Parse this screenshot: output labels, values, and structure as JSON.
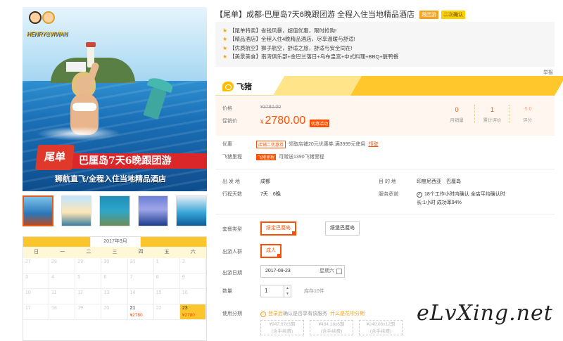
{
  "hero": {
    "logo_text": "HENRY&VIVIAN",
    "ribbon_tag": "尾单",
    "ribbon_text": "巴厘岛7天6晚跟团游",
    "subtitle": "狮航直飞/全程入住当地精品酒店"
  },
  "thumbnails": [
    "thumb-1",
    "thumb-2",
    "thumb-3",
    "thumb-4",
    "thumb-5"
  ],
  "calendar": {
    "month": "2017年9月",
    "weekdays": [
      "日",
      "一",
      "二",
      "三",
      "四",
      "五",
      "六"
    ],
    "cells": [
      {
        "day": "27",
        "state": "prev"
      },
      {
        "day": "28",
        "state": "prev"
      },
      {
        "day": "29",
        "state": "prev"
      },
      {
        "day": "30",
        "state": "prev"
      },
      {
        "day": "31",
        "state": "prev"
      },
      {
        "day": "1",
        "state": "past"
      },
      {
        "day": "2",
        "state": "past"
      },
      {
        "day": "3",
        "state": "past"
      },
      {
        "day": "4",
        "state": "past"
      },
      {
        "day": "5",
        "state": "past"
      },
      {
        "day": "6",
        "state": "past"
      },
      {
        "day": "7",
        "state": "past"
      },
      {
        "day": "8",
        "state": "past"
      },
      {
        "day": "9",
        "state": "past"
      },
      {
        "day": "10",
        "state": "past"
      },
      {
        "day": "11",
        "state": "past"
      },
      {
        "day": "12",
        "state": "past"
      },
      {
        "day": "13",
        "state": "past"
      },
      {
        "day": "14",
        "state": "past"
      },
      {
        "day": "15",
        "state": "past"
      },
      {
        "day": "16",
        "state": "past"
      },
      {
        "day": "17",
        "state": "past"
      },
      {
        "day": "18",
        "state": "past"
      },
      {
        "day": "19",
        "state": "past"
      },
      {
        "day": "20",
        "state": "past"
      },
      {
        "day": "21",
        "state": "available",
        "price": "¥2780"
      },
      {
        "day": "22",
        "state": "past"
      },
      {
        "day": "23",
        "state": "selected",
        "price": "¥2780"
      }
    ]
  },
  "product": {
    "title": "【尾单】成都-巴厘岛7天6晚跟团游 全程入住当地精品酒店",
    "badges": [
      "跟团游",
      "二次确认"
    ],
    "features": [
      "【尾单特卖】省钱风暴，超值优惠，限时抢购!",
      "【精品酒店】全程入住4晚精品酒店，尽享温暖与舒适!",
      "【优质航空】狮子航空，舒适之旅，舒适与安全同在!",
      "【美景美食】南湾俱乐部+金巴兰落日+乌布皇宫+中式料理+BBQ+脏鸭餐"
    ],
    "report": "举报"
  },
  "fliggy": {
    "name": "飞猪"
  },
  "pricing": {
    "price_label": "价格",
    "original": "¥3780.00",
    "promo_label": "促销价",
    "currency": "¥",
    "current": "2780.00",
    "promo_tag": "优惠活动",
    "stats": [
      {
        "value": "0",
        "label": "月销量"
      },
      {
        "value": "1",
        "label": "累计评价"
      },
      {
        "value": "-5.0",
        "label": "评分"
      }
    ]
  },
  "promotions": {
    "discount_label": "优惠",
    "discount_tag": "店铺二优惠券",
    "discount_text": "领取店铺20元优惠券,满3999元使用",
    "discount_link": "领取",
    "miles_label": "飞猪里程",
    "miles_tag": "飞猪里程",
    "miles_text": "可赠送1390飞猪里程"
  },
  "info": {
    "departure_label": "出 发 地",
    "departure": "成都",
    "destination_label": "目 的 地",
    "destination": "印度尼西亚　巴厘岛",
    "days_label": "行程天数",
    "days": "7天　6晚",
    "service_label": "服务承诺",
    "service_line1": "18个工作小时内确认 全店平均确认时",
    "service_line2": "长:1小时 成功率94%"
  },
  "options": {
    "package_label": "套餐类型",
    "packages": [
      "绥定巴厘岛",
      "绥堡巴厘岛"
    ],
    "crowd_label": "出游人群",
    "crowd": "成人",
    "date_label": "出游日期",
    "date": "2017-09-23",
    "weekday": "星期六",
    "qty_label": "数量",
    "qty": "1",
    "stock": "库存10件",
    "installment_label": "使用分期",
    "login_text": "登录后",
    "huabei_text": "确认是否享有该服务",
    "huabei_link": "什么是花呗分期",
    "installments": [
      {
        "amount": "¥947.97x3期",
        "fee": "(含手续费)"
      },
      {
        "amount": "¥484.18x6期",
        "fee": "(含手续费)"
      },
      {
        "amount": "¥249.03x12期",
        "fee": "(含手续费)"
      }
    ]
  },
  "watermark": "eLvXing.net",
  "colors": {
    "accent": "#ff5000",
    "yellow": "#fbc52d",
    "orange": "#f7a21b"
  }
}
